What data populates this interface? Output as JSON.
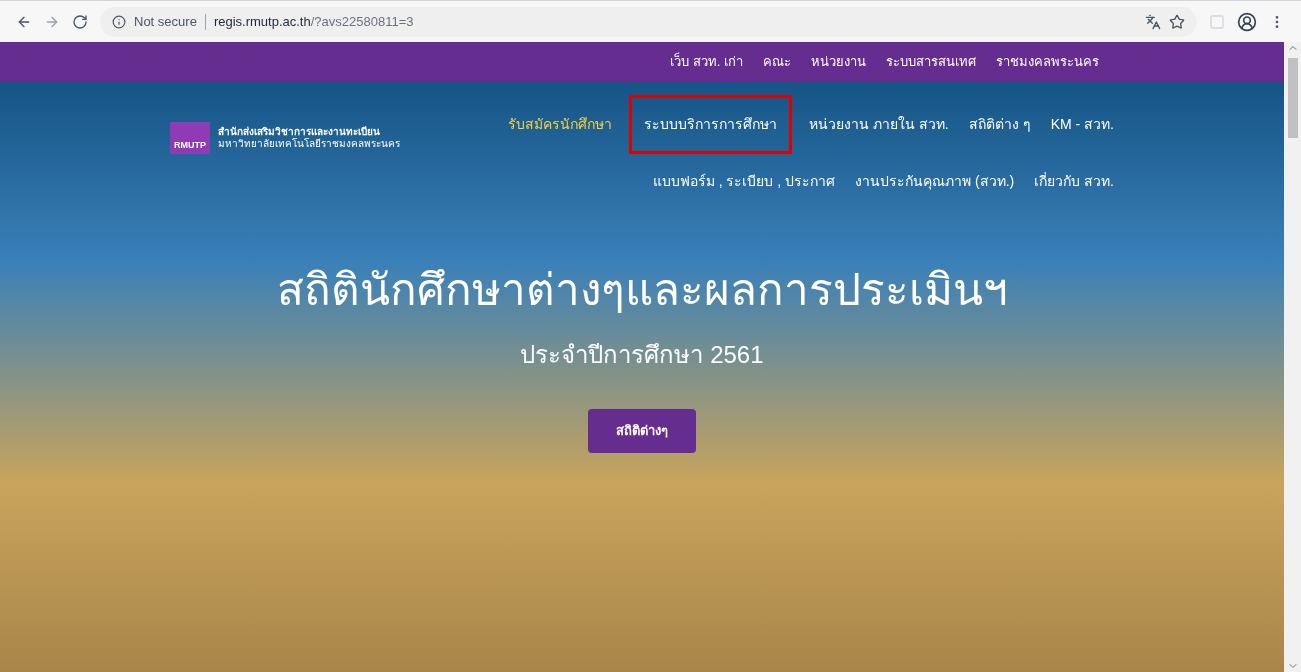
{
  "browser": {
    "security": "Not secure",
    "url_host": "regis.rmutp.ac.th",
    "url_path": "/?avs22580811=3"
  },
  "top_nav": [
    "เว็บ สวท. เก่า",
    "คณะ",
    "หน่วยงาน",
    "ระบบสารสนเทศ",
    "ราชมงคลพระนคร"
  ],
  "logo": {
    "badge": "RMUTP",
    "line_1": "สำนักส่งเสริมวิชาการและงานทะเบียน",
    "line_2": "มหาวิทยาลัยเทคโนโลยีราชมงคลพระนคร"
  },
  "main_nav": [
    {
      "label": "รับสมัครนักศึกษา",
      "selected": true,
      "highlighted": false
    },
    {
      "label": "ระบบบริการการศึกษา",
      "selected": false,
      "highlighted": true
    },
    {
      "label": "หน่วยงาน ภายใน สวท.",
      "selected": false,
      "highlighted": false
    },
    {
      "label": "สถิติต่าง ๆ",
      "selected": false,
      "highlighted": false
    },
    {
      "label": "KM - สวท.",
      "selected": false,
      "highlighted": false
    }
  ],
  "main_nav_row_2": [
    "แบบฟอร์ม , ระเบียบ , ประกาศ",
    "งานประกันคุณภาพ (สวท.)",
    "เกี่ยวกับ สวท."
  ],
  "hero": {
    "title": "สถิตินักศึกษาต่างๆและผลการประเมินฯ",
    "subtitle": "ประจำปีการศึกษา 2561",
    "button": "สถิติต่างๆ"
  }
}
